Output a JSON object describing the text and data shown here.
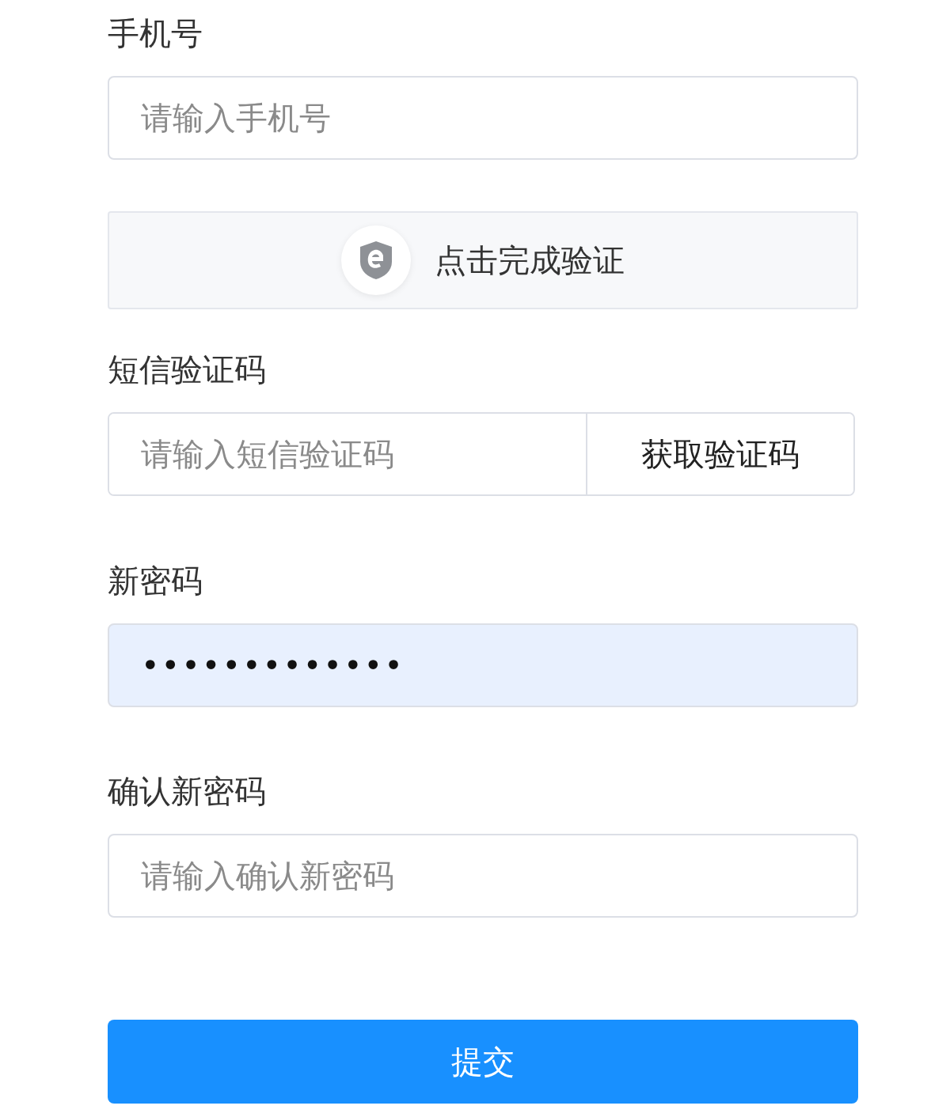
{
  "fields": [
    {
      "kind": "text",
      "label": "手机号",
      "placeholder": "请输入手机号"
    },
    {
      "kind": "captcha",
      "text": "点击完成验证"
    },
    {
      "kind": "sms",
      "label": "短信验证码",
      "placeholder": "请输入短信验证码",
      "button": "获取验证码"
    },
    {
      "kind": "password",
      "label": "新密码",
      "value": "•••••••••••••",
      "autofilled": true
    },
    {
      "kind": "text",
      "label": "确认新密码",
      "placeholder": "请输入确认新密码"
    }
  ],
  "submit": "提交"
}
